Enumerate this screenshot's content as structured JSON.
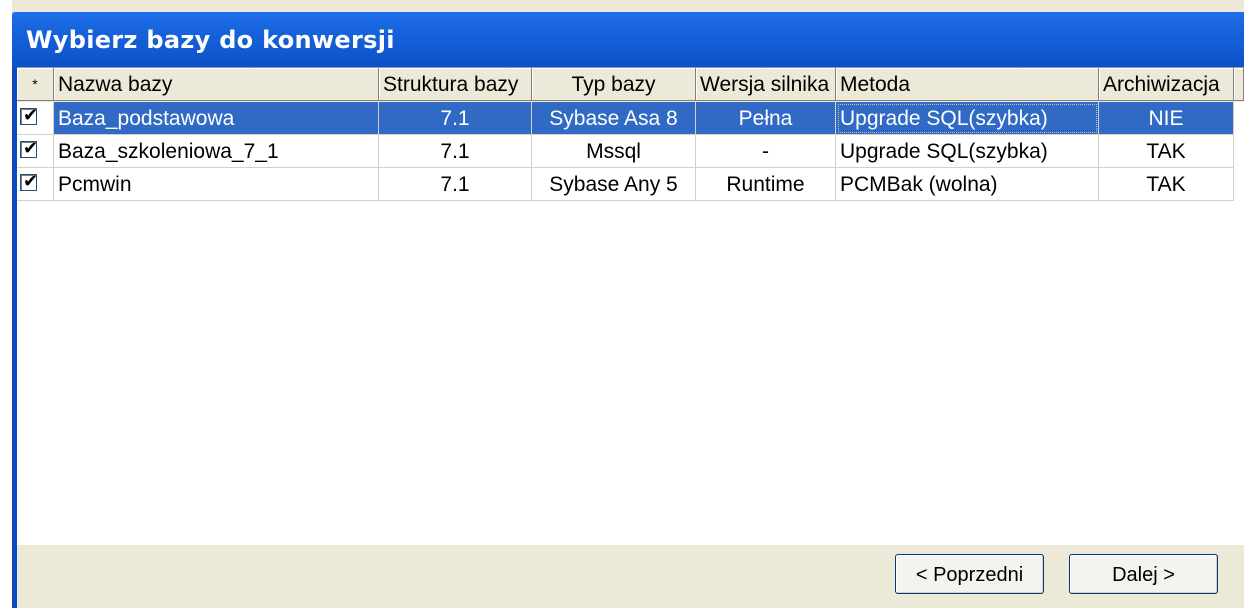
{
  "window": {
    "title": "Wybierz bazy do konwersji"
  },
  "grid": {
    "select_all_label": "*",
    "columns": [
      "Nazwa bazy",
      "Struktura bazy",
      "Typ bazy",
      "Wersja silnika",
      "Metoda",
      "Archiwizacja"
    ],
    "rows": [
      {
        "checked": "✔",
        "name": "Baza_podstawowa",
        "structure": "7.1",
        "type": "Sybase Asa 8",
        "engine": "Pełna",
        "method": "Upgrade SQL(szybka)",
        "archive": "NIE"
      },
      {
        "checked": "✔",
        "name": "Baza_szkoleniowa_7_1",
        "structure": "7.1",
        "type": "Mssql",
        "engine": "-",
        "method": "Upgrade SQL(szybka)",
        "archive": "TAK"
      },
      {
        "checked": "✔",
        "name": "Pcmwin",
        "structure": "7.1",
        "type": "Sybase Any 5",
        "engine": "Runtime",
        "method": "PCMBak (wolna)",
        "archive": "TAK"
      }
    ]
  },
  "buttons": {
    "previous": "< Poprzedni",
    "next": "Dalej >"
  },
  "colors": {
    "title_bar": "#1560d8",
    "selection": "#316ac5",
    "face": "#ece9d8"
  }
}
